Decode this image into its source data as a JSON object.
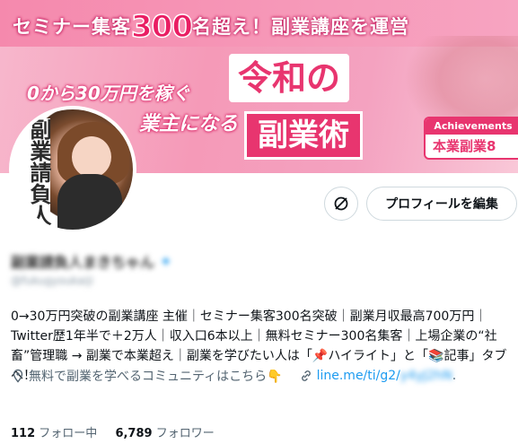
{
  "banner": {
    "headline_prefix": "セミナー集客",
    "headline_number": "300",
    "headline_suffix": "名超え！副業講座を運営",
    "line1": "0から30万円を稼ぐ",
    "line2": "業主になる",
    "big1": "令和の",
    "big2": "副業術",
    "achievements_title": "Achievements",
    "achievements_value": "本業副業8"
  },
  "avatar_text": "副業請負人",
  "actions": {
    "edit_profile_label": "プロフィールを編集"
  },
  "profile": {
    "display_name": "副業請負人まきちゃん",
    "handle": "@fukugyoukaiji",
    "bio": "0→30万円突破の副業講座 主催｜セミナー集客300名突破｜副業月収最高700万円｜Twitter歴1年半で＋2万人｜収入口6本以上｜無料セミナー300名集客｜上場企業の“社畜”管理職 → 副業で本業超え｜副業を学びたい人は「📌ハイライト」と「📚記事」タブへ！",
    "location": "無料で副業を学べるコミュニティはこちら👇",
    "link_visible": "line.me/ti/g2/",
    "link_blurred": "y4yJ2hN",
    "link_suffix": "."
  },
  "stats": {
    "following_count": "112",
    "following_label": "フォロー中",
    "followers_count": "6,789",
    "followers_label": "フォロワー"
  },
  "colors": {
    "accent_pink": "#e8356f",
    "link_blue": "#1d9bf0"
  },
  "icons": [
    "location-icon",
    "link-icon",
    "unfollow-icon"
  ]
}
